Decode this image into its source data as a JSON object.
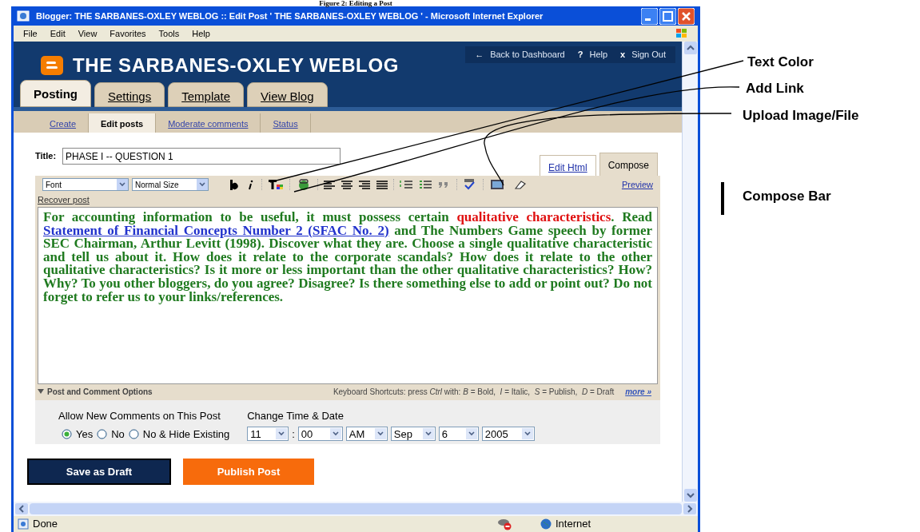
{
  "caption": "Figure 2: Editing a Post",
  "window": {
    "title": "Blogger: THE SARBANES-OXLEY WEBLOG :: Edit Post ' THE SARBANES-OXLEY WEBLOG ' - Microsoft Internet Explorer"
  },
  "menu": [
    "File",
    "Edit",
    "View",
    "Favorites",
    "Tools",
    "Help"
  ],
  "blog": {
    "title": "THE SARBANES-OXLEY WEBLOG",
    "links": [
      {
        "icon": "←",
        "label": "Back to Dashboard"
      },
      {
        "icon": "?",
        "label": "Help"
      },
      {
        "icon": "x",
        "label": "Sign Out"
      }
    ]
  },
  "tabs": [
    {
      "label": "Posting",
      "selected": true
    },
    {
      "label": "Settings",
      "selected": false
    },
    {
      "label": "Template",
      "selected": false
    },
    {
      "label": "View Blog",
      "selected": false
    }
  ],
  "subtabs": [
    {
      "label": "Create",
      "selected": false
    },
    {
      "label": "Edit posts",
      "selected": true
    },
    {
      "label": "Moderate comments",
      "selected": false
    },
    {
      "label": "Status",
      "selected": false
    }
  ],
  "title_field": {
    "label": "Title:",
    "value": "PHASE I -- QUESTION 1"
  },
  "editor_tabs": [
    {
      "label": "Edit Html",
      "selected": false
    },
    {
      "label": "Compose",
      "selected": true
    }
  ],
  "toolbar": {
    "font": "Font",
    "size": "Normal Size",
    "preview": "Preview"
  },
  "recover": "Recover post",
  "body": [
    {
      "kind": "plain",
      "text": "For accounting information to be useful, it must possess certain "
    },
    {
      "kind": "highlight",
      "text": "qualitative characteristics"
    },
    {
      "kind": "plain",
      "text": ". Read "
    },
    {
      "kind": "link",
      "text": "Statement of Financial Concepts Number 2 (SFAC No. 2)"
    },
    {
      "kind": "plain",
      "text": " and The Numbers Game speech by former SEC Chairman, Arthur Levitt (1998). Discover what they are. Choose a single qualitative characteristic and tell us about it. How does it relate to the corporate scandals? How does it relate to the other qualitative characteristics? Is it more or less important than the other qualitative characteristics? How? Why? To you other bloggers, do you agree? Disagree? Is there something else to add or point out? Do not forget to refer us to your links/references."
    }
  ],
  "options_bar": {
    "label": "Post and Comment Options",
    "shortcuts": "Keyboard Shortcuts: press *Ctrl* with: *B* = Bold,  *I* = Italic,  *S* = Publish,  *D* = Draft",
    "more": "more »"
  },
  "comments": {
    "label": "Allow New Comments on This Post",
    "options": [
      {
        "label": "Yes",
        "selected": true
      },
      {
        "label": "No",
        "selected": false
      },
      {
        "label": "No & Hide Existing",
        "selected": false
      }
    ]
  },
  "date": {
    "label": "Change Time & Date",
    "separator": ":",
    "selects": [
      "11",
      "00",
      "AM",
      "Sep",
      "6",
      "2005"
    ]
  },
  "buttons": [
    {
      "kind": "draft",
      "label": "Save as Draft"
    },
    {
      "kind": "publish",
      "label": "Publish Post"
    }
  ],
  "status": {
    "left": "Done",
    "zone": "Internet"
  },
  "annotations": [
    {
      "label": "Text Color"
    },
    {
      "label": "Add Link"
    },
    {
      "label": "Upload Image/File"
    }
  ],
  "compose_bar": "Compose Bar"
}
